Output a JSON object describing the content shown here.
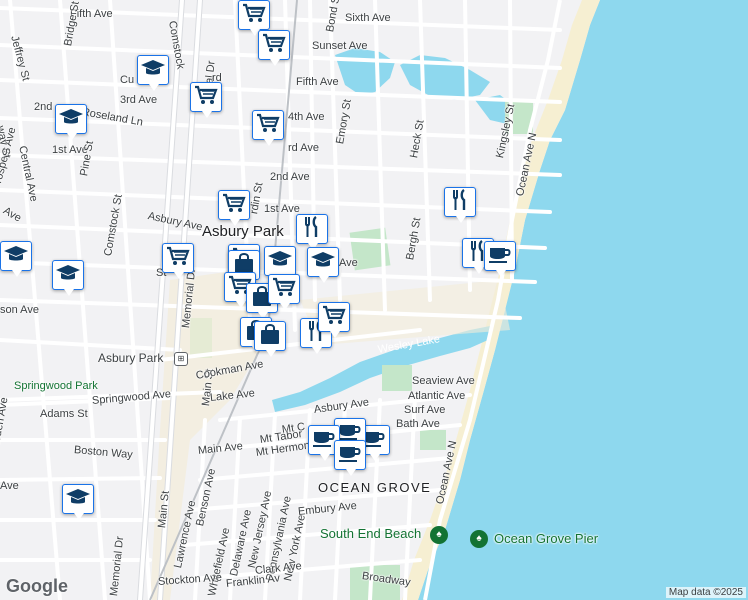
{
  "map": {
    "labels": {
      "place_asbury_park": "Asbury Park",
      "place_ocean_grove": "OCEAN GROVE",
      "station_asbury_park": "Asbury Park",
      "water_wesley_lake": "Wesley Lake",
      "park_springwood": "Springwood Park",
      "poi_south_end_beach": "South End Beach",
      "poi_ocean_grove_pier": "Ocean Grove Pier",
      "st_fifth_ave_w": "Fifth Ave",
      "st_sixth_ave": "Sixth Ave",
      "st_sunset_ave": "Sunset Ave",
      "st_fifth_ave": "Fifth Ave",
      "st_4th_ave": "4th Ave",
      "st_3rd_ave": "3rd Ave",
      "st_3rd_ave_e": "rd Ave",
      "st_2nd_ave_w": "2nd",
      "st_2nd_ave": "2nd Ave",
      "st_1st_ave_w": "1st Ave",
      "st_1st_ave": "1st Ave",
      "st_asbury_ave": "Asbury Ave",
      "st_ave_frag": "Ave",
      "st_roseland_ln": "Roseland Ln",
      "st_jeffrey_st": "Jeffrey St",
      "st_bridge_st": "Bridge St",
      "st_comstock_st_n": "Comstock",
      "st_comstock_st": "Comstock St",
      "st_central_ave": "Central Ave",
      "st_pine_st": "Pine St",
      "st_prospect_ave": "Prospect Ave",
      "st_prospect_frag": "Ave",
      "st_way_st": "way St",
      "st_emory_st": "Emory St",
      "st_heck_st": "Heck St",
      "st_bergh_st": "Bergh St",
      "st_kingsley_st": "Kingsley St",
      "st_ocean_ave_n": "Ocean Ave N",
      "st_ocean_ave_n2": "Ocean Ave N",
      "st_memorial_dr": "Memorial Dr",
      "st_memorial_dr_n": "orial Dr",
      "st_memorial_dr_s": "Memorial Dr",
      "st_main_st": "Main St",
      "st_main_st_s": "Main St",
      "st_bond_st": "Bond St",
      "st_rdin_st": "rdin St",
      "st_st_frag": "St",
      "st_rd": "rd",
      "st_cu": "Cu",
      "st_cookman_ave": "Cookman Ave",
      "st_springwood_ave": "Springwood Ave",
      "st_lake_ave": "Lake Ave",
      "st_adams_st": "Adams St",
      "st_boston_way": "Boston Way",
      "st_sewall_ave": "son Ave",
      "st_borden_ave": "orden Ave",
      "st_ave_left": "Ave",
      "st_seaview_ave": "Seaview Ave",
      "st_atlantic_ave": "Atlantic Ave",
      "st_surf_ave": "Surf Ave",
      "st_bath_ave": "Bath Ave",
      "st_asbury_ave_s": "Asbury Ave",
      "st_mt_carmel": "Mt C",
      "st_mt_tabor": "Mt Tabor",
      "st_mt_hermon": "Mt Hermon Way",
      "st_main_ave": "Main Ave",
      "st_lawrence_ave": "Lawrence Ave",
      "st_benson_ave": "Benson Ave",
      "st_whitefield_ave": "Whitefield Ave",
      "st_delaware_ave": "Delaware Ave",
      "st_new_jersey_ave": "New Jersey Ave",
      "st_pennsylvania_ave": "Pennsylvania Ave",
      "st_new_york_ave": "New York Ave",
      "st_embury_ave": "Embury Ave",
      "st_clark_ave": "Clark Ave",
      "st_franklin_ave": "Franklin Av",
      "st_stockton_ave": "Stockton Ave",
      "st_broadway": "Broadway"
    },
    "attribution": "Map data ©2025",
    "logo": "Google",
    "station_glyph": "⊞",
    "poi_glyph": "♠",
    "colors": {
      "land": "#f2f2f4",
      "water": "#8ed8ee",
      "beach": "#f6efd2",
      "park": "#c4e6c9",
      "road": "#ffffff",
      "pin_border": "#1a73e8",
      "icon": "#0f3d66"
    }
  },
  "markers": [
    {
      "type": "grocery-icon"
    },
    {
      "type": "grocery-icon"
    },
    {
      "type": "school-icon"
    },
    {
      "type": "grocery-icon"
    },
    {
      "type": "grocery-icon"
    },
    {
      "type": "school-icon"
    },
    {
      "type": "grocery-icon"
    },
    {
      "type": "grocery-icon"
    },
    {
      "type": "restaurant-icon"
    },
    {
      "type": "restaurant-icon"
    },
    {
      "type": "grocery-icon"
    },
    {
      "type": "shopping-bag-icon"
    },
    {
      "type": "school-icon"
    },
    {
      "type": "school-icon"
    },
    {
      "type": "school-icon"
    },
    {
      "type": "school-icon"
    },
    {
      "type": "restaurant-icon"
    },
    {
      "type": "cafe-icon"
    },
    {
      "type": "grocery-icon"
    },
    {
      "type": "shopping-bag-icon"
    },
    {
      "type": "grocery-icon"
    },
    {
      "type": "shopping-bag-icon"
    },
    {
      "type": "shopping-bag-icon"
    },
    {
      "type": "restaurant-icon"
    },
    {
      "type": "grocery-icon"
    },
    {
      "type": "cafe-icon"
    },
    {
      "type": "cafe-icon"
    },
    {
      "type": "cafe-icon"
    },
    {
      "type": "cafe-icon"
    },
    {
      "type": "school-icon"
    }
  ]
}
